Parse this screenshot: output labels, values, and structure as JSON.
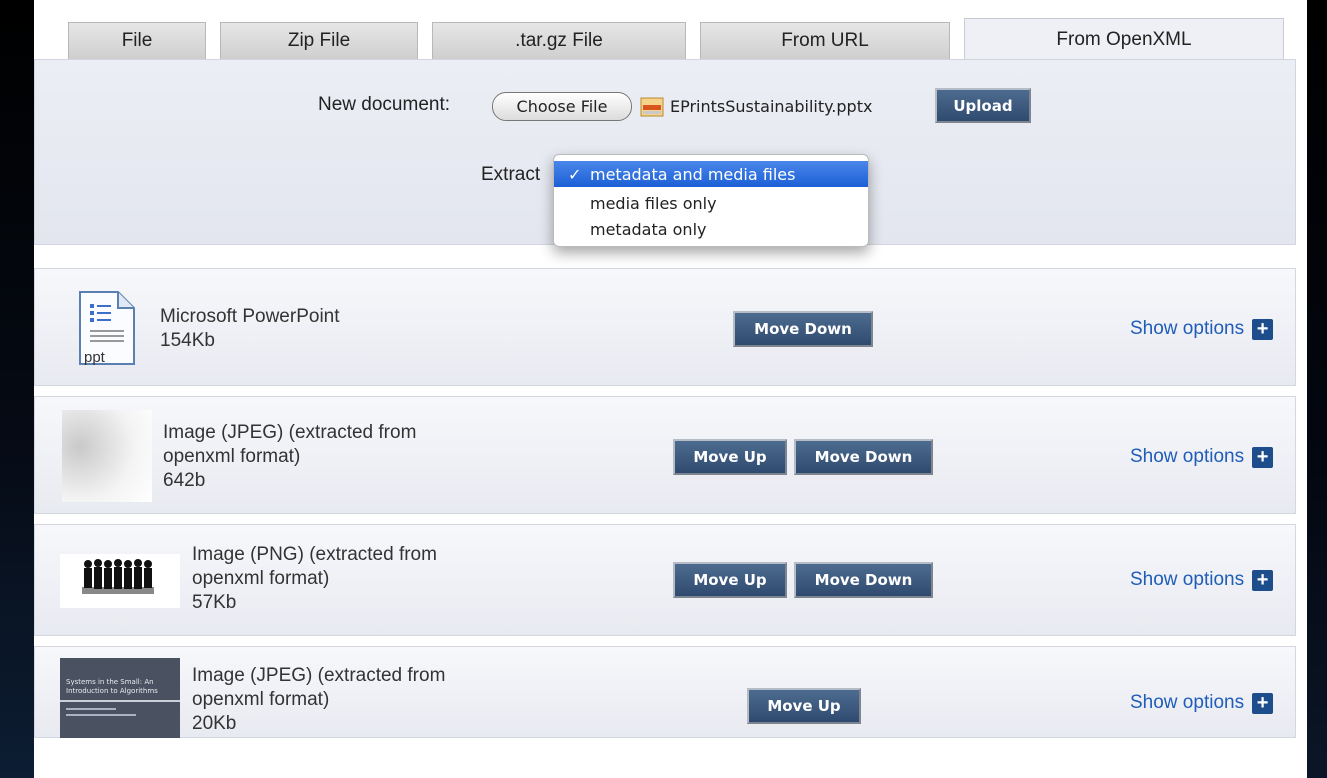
{
  "tabs": [
    {
      "label": "File"
    },
    {
      "label": "Zip File"
    },
    {
      "label": ".tar.gz File"
    },
    {
      "label": "From URL"
    },
    {
      "label": "From OpenXML",
      "active": true
    }
  ],
  "upload": {
    "new_document_label": "New document:",
    "choose_file_label": "Choose File",
    "file_name": "EPrintsSustainability.pptx",
    "upload_label": "Upload",
    "extract_label": "Extract",
    "extract_options": [
      "metadata and media files",
      "media files only",
      "metadata only"
    ],
    "extract_selected": "metadata and media files",
    "check_glyph": "✓"
  },
  "documents": [
    {
      "format": "Microsoft PowerPoint",
      "size": "154Kb",
      "icon": "ppt-file-icon",
      "icon_text": "ppt",
      "buttons": [
        "Move Down"
      ],
      "show_options": "Show options"
    },
    {
      "format": "Image (JPEG) (extracted from openxml format)",
      "format_line1": "Image (JPEG) (extracted from",
      "format_line2": "openxml format)",
      "size": "642b",
      "buttons": [
        "Move Up",
        "Move Down"
      ],
      "show_options": "Show options"
    },
    {
      "format": "Image (PNG) (extracted from openxml format)",
      "format_line1": "Image (PNG) (extracted from",
      "format_line2": "openxml format)",
      "size": "57Kb",
      "buttons": [
        "Move Up",
        "Move Down"
      ],
      "show_options": "Show options"
    },
    {
      "format": "Image (JPEG) (extracted from openxml format)",
      "format_line1": "Image (JPEG) (extracted from",
      "format_line2": "openxml format)",
      "size": "20Kb",
      "buttons": [
        "Move Up"
      ],
      "show_options": "Show options",
      "thumb_title": "Systems in the Small: An Introduction to Algorithms"
    }
  ],
  "plus_glyph": "+",
  "colors": {
    "link": "#1f5db8",
    "dark_button": "#3a5a80",
    "selected_option": "#2a6ee0"
  }
}
